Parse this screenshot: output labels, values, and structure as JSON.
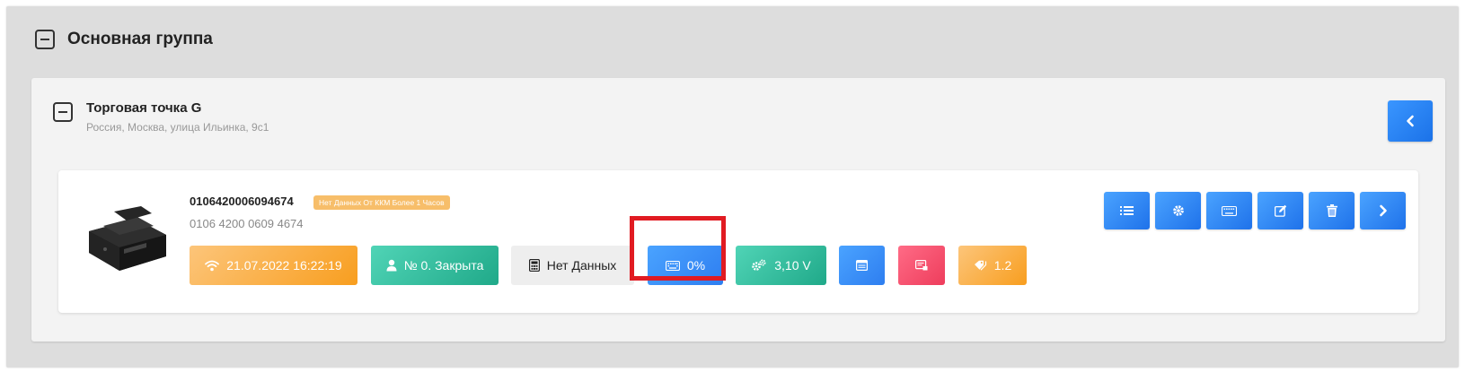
{
  "group": {
    "title": "Основная группа",
    "toggle_icon": "minus-square-icon"
  },
  "store": {
    "name": "Торговая точка G",
    "address": "Россия, Москва, улица Ильинка, 9с1",
    "back_icon": "chevron-left-icon"
  },
  "device": {
    "serial": "0106420006094674",
    "warning_badge": "Нет Данных От ККМ Более 1 Часов",
    "serial_formatted": "0106 4200 0609 4674",
    "image": "receipt-printer-image"
  },
  "chips": {
    "last_connection": "21.07.2022 16:22:19",
    "shift": "№ 0. Закрыта",
    "fiscal": "Нет Данных",
    "keyboard_percent": "0%",
    "voltage": "3,10 V",
    "version": "1.2"
  },
  "colors": {
    "accent_blue": "#2e7ef0",
    "orange": "#f89e1f",
    "teal": "#20a989",
    "red": "#ee3d5c",
    "highlight": "#e11b22"
  },
  "actions": [
    {
      "name": "list-button",
      "icon": "list-icon"
    },
    {
      "name": "settings-button",
      "icon": "gear-icon"
    },
    {
      "name": "keyboard-button",
      "icon": "keyboard-icon"
    },
    {
      "name": "edit-button",
      "icon": "edit-icon"
    },
    {
      "name": "delete-button",
      "icon": "trash-icon"
    },
    {
      "name": "next-button",
      "icon": "chevron-right-icon"
    }
  ]
}
